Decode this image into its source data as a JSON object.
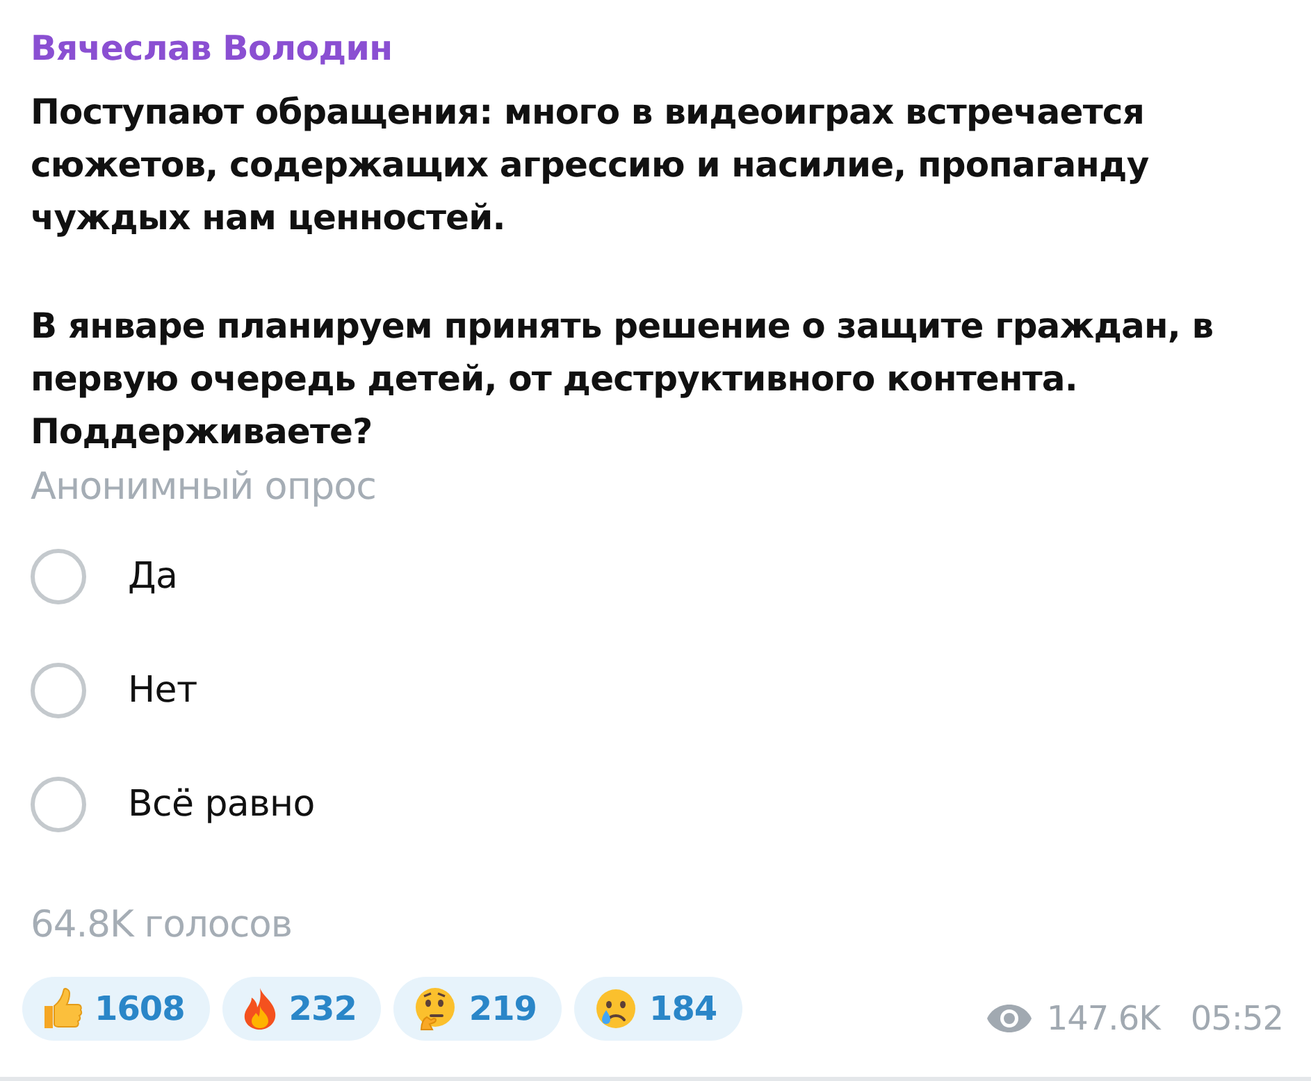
{
  "post": {
    "author": "Вячеслав Володин",
    "paragraphs": [
      "Поступают обращения: много в видеоиграх встречается сюжетов, содержащих агрессию и насилие, пропаганду чуждых нам ценностей.",
      "В январе планируем принять решение о защите граждан, в первую очередь детей, от деструктивного контента. Поддерживаете?"
    ]
  },
  "poll": {
    "type_label": "Анонимный опрос",
    "options": [
      {
        "label": "Да",
        "selected": false
      },
      {
        "label": "Нет",
        "selected": false
      },
      {
        "label": "Всё равно",
        "selected": false
      }
    ],
    "votes": "64.8K голосов"
  },
  "reactions": [
    {
      "kind": "thumbs-up",
      "count": "1608"
    },
    {
      "kind": "fire",
      "count": "232"
    },
    {
      "kind": "thinking",
      "count": "219"
    },
    {
      "kind": "crying",
      "count": "184"
    }
  ],
  "footer": {
    "views": "147.6K",
    "time": "05:52"
  }
}
